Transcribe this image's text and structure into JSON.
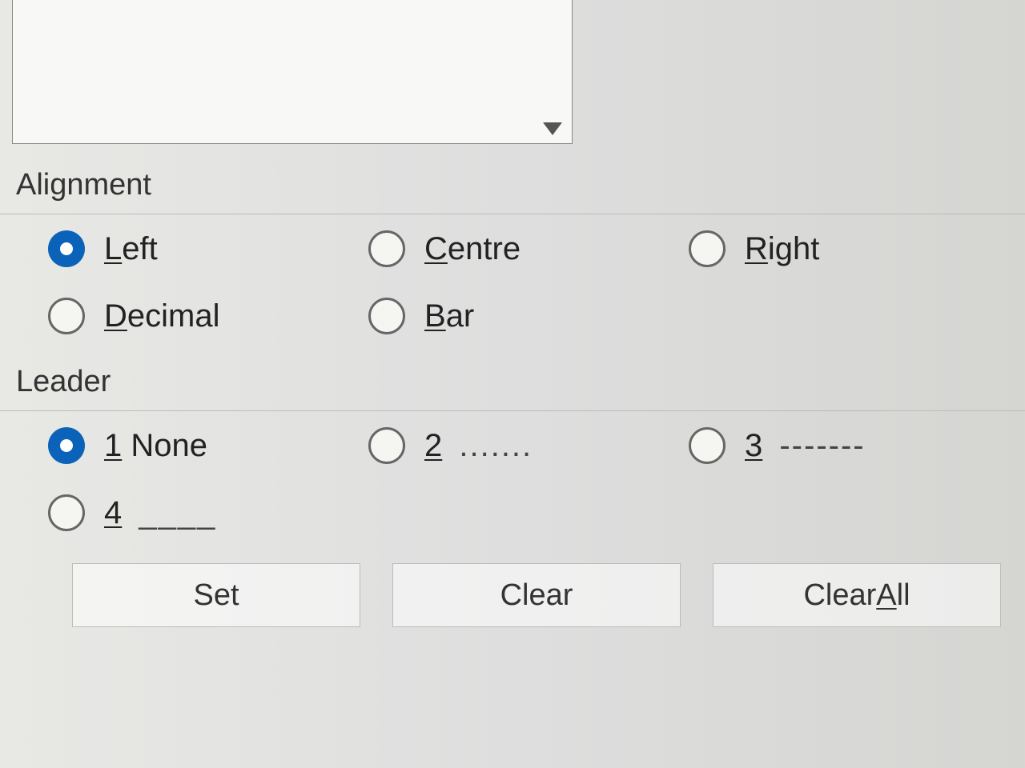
{
  "sections": {
    "alignment_label": "Alignment",
    "leader_label": "Leader"
  },
  "alignment": {
    "left": {
      "mnemonic": "L",
      "rest": "eft",
      "selected": true
    },
    "centre": {
      "mnemonic": "C",
      "rest": "entre",
      "selected": false
    },
    "right": {
      "mnemonic": "R",
      "rest": "ight",
      "selected": false
    },
    "decimal": {
      "mnemonic": "D",
      "rest": "ecimal",
      "selected": false
    },
    "bar": {
      "mnemonic": "B",
      "rest": "ar",
      "selected": false
    }
  },
  "leader": {
    "none": {
      "mnemonic": "1",
      "rest": " None",
      "selected": true
    },
    "dots": {
      "mnemonic": "2",
      "rest": "",
      "sample": " .......",
      "selected": false
    },
    "dashes": {
      "mnemonic": "3",
      "rest": "",
      "sample": " -------",
      "selected": false
    },
    "underline": {
      "mnemonic": "4",
      "rest": "",
      "sample": " ____",
      "selected": false
    }
  },
  "buttons": {
    "set": "Set",
    "clear": "Clear",
    "clear_all_pre": "Clear ",
    "clear_all_mnemonic": "A",
    "clear_all_post": "ll"
  }
}
